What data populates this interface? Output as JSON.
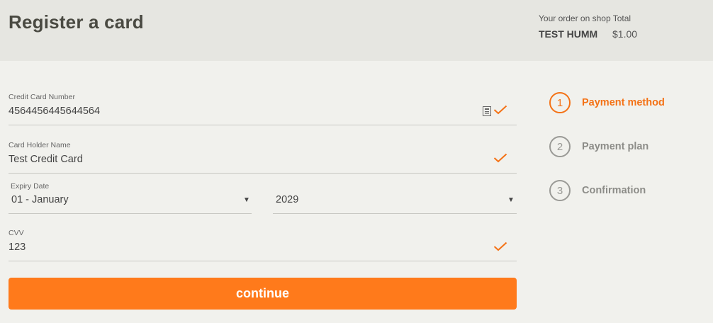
{
  "header": {
    "title": "Register a card",
    "order_caption": "Your order on shop Total",
    "shop_name": "TEST HUMM",
    "total": "$1.00"
  },
  "form": {
    "card_number": {
      "label": "Credit Card Number",
      "value": "4564456445644564"
    },
    "holder_name": {
      "label": "Card Holder Name",
      "value": "Test Credit Card"
    },
    "expiry": {
      "label": "Expiry Date",
      "month": "01 - January",
      "year": "2029"
    },
    "cvv": {
      "label": "CVV",
      "value": "123"
    },
    "continue_label": "continue"
  },
  "steps": [
    {
      "number": "1",
      "label": "Payment method",
      "active": true
    },
    {
      "number": "2",
      "label": "Payment plan",
      "active": false
    },
    {
      "number": "3",
      "label": "Confirmation",
      "active": false
    }
  ],
  "colors": {
    "accent": "#ff7a1b",
    "check": "#f47216",
    "background": "#f1f1ed",
    "header_bg": "#e6e6e1"
  },
  "icons": {
    "check": "check-icon",
    "card": "card-icon",
    "caret": "caret-down-icon"
  }
}
